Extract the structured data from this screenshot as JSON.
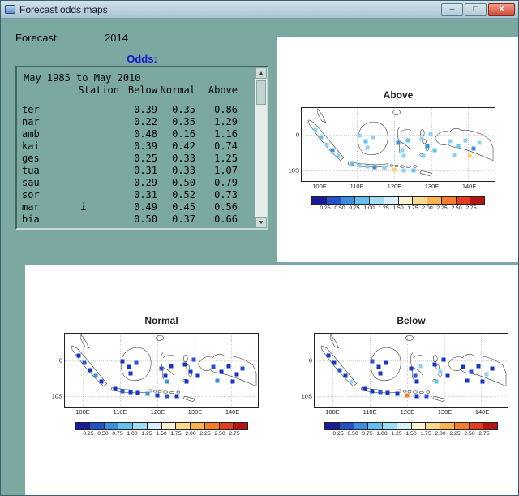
{
  "window": {
    "title": "Forecast odds maps",
    "controls": {
      "minimize": "–",
      "maximize": "□",
      "close": "×"
    }
  },
  "forecast": {
    "label": "Forecast:",
    "value": "2014"
  },
  "odds": {
    "label": "Odds:",
    "period": "May 1985 to May 2010",
    "columns": [
      "Station",
      "Below",
      "Normal",
      "Above"
    ],
    "rows": [
      {
        "station": "ter",
        "below": "0.39",
        "normal": "0.35",
        "above": "0.86"
      },
      {
        "station": "nar",
        "below": "0.22",
        "normal": "0.35",
        "above": "1.29"
      },
      {
        "station": "amb",
        "below": "0.48",
        "normal": "0.16",
        "above": "1.16"
      },
      {
        "station": "kai",
        "below": "0.39",
        "normal": "0.42",
        "above": "0.74"
      },
      {
        "station": "ges",
        "below": "0.25",
        "normal": "0.33",
        "above": "1.25"
      },
      {
        "station": "tua",
        "below": "0.31",
        "normal": "0.33",
        "above": "1.07"
      },
      {
        "station": "sau",
        "below": "0.29",
        "normal": "0.50",
        "above": "0.79"
      },
      {
        "station": "sor",
        "below": "0.31",
        "normal": "0.52",
        "above": "0.73"
      },
      {
        "station": "mar       i",
        "below": "0.49",
        "normal": "0.45",
        "above": "0.56"
      },
      {
        "station": "bia",
        "below": "0.50",
        "normal": "0.37",
        "above": "0.66"
      }
    ],
    "scrollbar": {
      "up": "▲",
      "down": "▼"
    }
  },
  "map_axes": {
    "lat_labels": [
      "0",
      "10S"
    ],
    "lon_labels": [
      "100E",
      "110E",
      "120E",
      "130E",
      "140E"
    ],
    "lon_positions": [
      9.6,
      28.8,
      48.1,
      67.3,
      86.5
    ]
  },
  "colorbar": {
    "ticks": [
      "0.25",
      "0.50",
      "0.75",
      "1.00",
      "1.25",
      "1.50",
      "1.75",
      "2.00",
      "2.25",
      "2.50",
      "2.75"
    ],
    "colors": [
      "#1a1a9c",
      "#2450c8",
      "#3c8ce0",
      "#64c0ee",
      "#a0dcf6",
      "#d8f0fb",
      "#fdf2d2",
      "#fcdc8c",
      "#fcb44e",
      "#f87d2a",
      "#e63c1e",
      "#b41414"
    ]
  },
  "maps": [
    {
      "title": "Above",
      "markers": [
        [
          7,
          30,
          "#8ed2f0"
        ],
        [
          10,
          40,
          "#62c4ea"
        ],
        [
          13,
          50,
          "#8ed2f0"
        ],
        [
          16,
          58,
          "#3f8fd6"
        ],
        [
          19,
          66,
          "#8ed2f0"
        ],
        [
          26,
          76,
          "#62c4ea"
        ],
        [
          30,
          79,
          "#8ed2f0"
        ],
        [
          34,
          80,
          "#8ed2f0"
        ],
        [
          38,
          81,
          "#3f8fd6"
        ],
        [
          43,
          82,
          "#8ed2f0"
        ],
        [
          30,
          38,
          "#8ed2f0"
        ],
        [
          33,
          46,
          "#62c4ea"
        ],
        [
          37,
          40,
          "#8ed2f0"
        ],
        [
          34,
          54,
          "#8ed2f0"
        ],
        [
          50,
          48,
          "#3f8fd6"
        ],
        [
          52,
          58,
          "#8ed2f0"
        ],
        [
          55,
          44,
          "#62c4ea"
        ],
        [
          53,
          66,
          "#8ed2f0"
        ],
        [
          48,
          84,
          "#fcd268"
        ],
        [
          53,
          86,
          "#8ed2f0"
        ],
        [
          58,
          85,
          "#62c4ea"
        ],
        [
          62,
          42,
          "#8ed2f0"
        ],
        [
          65,
          52,
          "#3f8fd6"
        ],
        [
          67,
          36,
          "#8ed2f0"
        ],
        [
          69,
          58,
          "#62c4ea"
        ],
        [
          63,
          66,
          "#8ed2f0"
        ],
        [
          77,
          46,
          "#8ed2f0"
        ],
        [
          81,
          52,
          "#62c4ea"
        ],
        [
          85,
          44,
          "#8ed2f0"
        ],
        [
          89,
          56,
          "#3f8fd6"
        ],
        [
          79,
          64,
          "#8ed2f0"
        ],
        [
          87,
          66,
          "#fcd268"
        ],
        [
          92,
          48,
          "#8ed2f0"
        ]
      ]
    },
    {
      "title": "Normal",
      "markers": [
        [
          7,
          30,
          "#1535c8"
        ],
        [
          10,
          40,
          "#2a52d8"
        ],
        [
          13,
          50,
          "#1535c8"
        ],
        [
          16,
          58,
          "#3f8fd6"
        ],
        [
          19,
          66,
          "#1535c8"
        ],
        [
          26,
          76,
          "#1535c8"
        ],
        [
          30,
          79,
          "#2a52d8"
        ],
        [
          34,
          80,
          "#1535c8"
        ],
        [
          38,
          81,
          "#1535c8"
        ],
        [
          43,
          82,
          "#3f8fd6"
        ],
        [
          30,
          38,
          "#1535c8"
        ],
        [
          33,
          46,
          "#1535c8"
        ],
        [
          37,
          40,
          "#2a52d8"
        ],
        [
          34,
          54,
          "#1535c8"
        ],
        [
          50,
          48,
          "#2a52d8"
        ],
        [
          52,
          58,
          "#1535c8"
        ],
        [
          55,
          44,
          "#1535c8"
        ],
        [
          53,
          66,
          "#3f8fd6"
        ],
        [
          48,
          84,
          "#1535c8"
        ],
        [
          53,
          86,
          "#2a52d8"
        ],
        [
          58,
          85,
          "#1535c8"
        ],
        [
          62,
          42,
          "#1535c8"
        ],
        [
          65,
          52,
          "#1535c8"
        ],
        [
          67,
          36,
          "#2a52d8"
        ],
        [
          69,
          58,
          "#1535c8"
        ],
        [
          63,
          66,
          "#1535c8"
        ],
        [
          77,
          46,
          "#2a52d8"
        ],
        [
          81,
          52,
          "#1535c8"
        ],
        [
          85,
          44,
          "#1535c8"
        ],
        [
          89,
          56,
          "#1535c8"
        ],
        [
          79,
          64,
          "#3f8fd6"
        ],
        [
          87,
          66,
          "#1535c8"
        ],
        [
          92,
          48,
          "#2a52d8"
        ]
      ]
    },
    {
      "title": "Below",
      "markers": [
        [
          7,
          30,
          "#1535c8"
        ],
        [
          10,
          40,
          "#1535c8"
        ],
        [
          13,
          50,
          "#2a52d8"
        ],
        [
          16,
          58,
          "#1535c8"
        ],
        [
          19,
          66,
          "#8ed2f0"
        ],
        [
          26,
          76,
          "#1535c8"
        ],
        [
          30,
          79,
          "#1535c8"
        ],
        [
          34,
          80,
          "#2a52d8"
        ],
        [
          38,
          81,
          "#1535c8"
        ],
        [
          43,
          82,
          "#1535c8"
        ],
        [
          30,
          38,
          "#2a52d8"
        ],
        [
          33,
          46,
          "#1535c8"
        ],
        [
          37,
          40,
          "#1535c8"
        ],
        [
          34,
          54,
          "#1535c8"
        ],
        [
          50,
          48,
          "#1535c8"
        ],
        [
          52,
          58,
          "#2a52d8"
        ],
        [
          55,
          44,
          "#8ed2f0"
        ],
        [
          53,
          66,
          "#1535c8"
        ],
        [
          48,
          84,
          "#f87d2a"
        ],
        [
          53,
          86,
          "#1535c8"
        ],
        [
          58,
          85,
          "#2a52d8"
        ],
        [
          62,
          42,
          "#1535c8"
        ],
        [
          65,
          52,
          "#8ed2f0"
        ],
        [
          67,
          36,
          "#1535c8"
        ],
        [
          69,
          58,
          "#1535c8"
        ],
        [
          63,
          66,
          "#62c4ea"
        ],
        [
          77,
          46,
          "#1535c8"
        ],
        [
          81,
          52,
          "#2a52d8"
        ],
        [
          85,
          44,
          "#1535c8"
        ],
        [
          89,
          56,
          "#8ed2f0"
        ],
        [
          79,
          64,
          "#1535c8"
        ],
        [
          87,
          66,
          "#1535c8"
        ],
        [
          92,
          48,
          "#1535c8"
        ]
      ]
    }
  ]
}
